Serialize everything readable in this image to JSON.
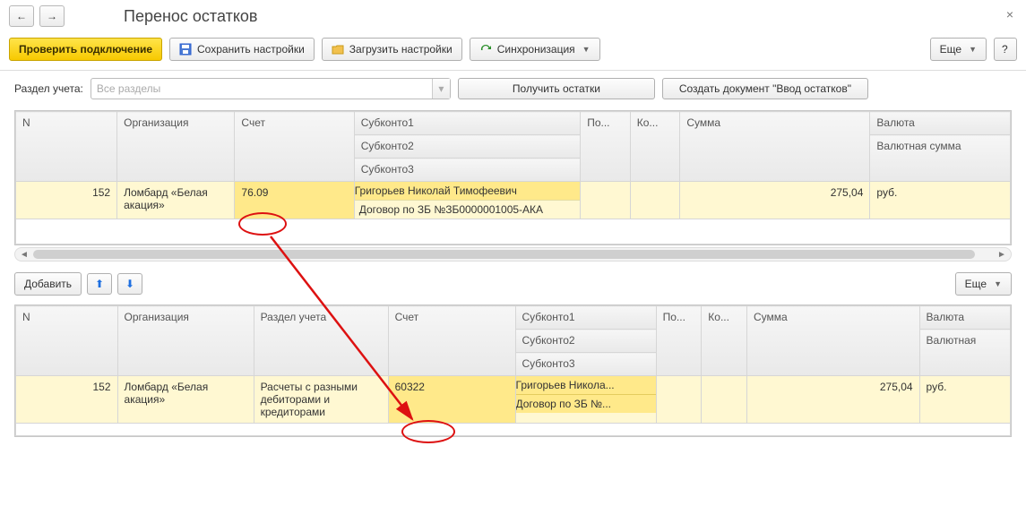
{
  "header": {
    "title": "Перенос остатков"
  },
  "nav": {
    "back_label": "←",
    "fwd_label": "→"
  },
  "toolbar": {
    "check_conn": "Проверить подключение",
    "save_settings": "Сохранить настройки",
    "load_settings": "Загрузить настройки",
    "sync": "Синхронизация",
    "more": "Еще",
    "help": "?"
  },
  "filter": {
    "label": "Раздел учета:",
    "placeholder": "Все разделы",
    "get_balances": "Получить остатки",
    "create_doc": "Создать документ \"Ввод остатков\""
  },
  "table1": {
    "cols": {
      "n": "N",
      "org": "Организация",
      "acct": "Счет",
      "sub1": "Субконто1",
      "sub2": "Субконто2",
      "sub3": "Субконто3",
      "po": "По...",
      "ko": "Ко...",
      "sum": "Сумма",
      "cur": "Валюта",
      "cur_sum": "Валютная сумма"
    },
    "row": {
      "n": "152",
      "org": "Ломбард «Белая акация»",
      "acct": "76.09",
      "sub1": "Григорьев Николай Тимофеевич",
      "sub2": "Договор по ЗБ №ЗБ0000001005-АКА",
      "sum": "275,04",
      "cur": "руб."
    }
  },
  "mid_toolbar": {
    "add": "Добавить",
    "more": "Еще"
  },
  "table2": {
    "cols": {
      "n": "N",
      "org": "Организация",
      "section": "Раздел учета",
      "acct": "Счет",
      "sub1": "Субконто1",
      "sub2": "Субконто2",
      "sub3": "Субконто3",
      "po": "По...",
      "ko": "Ко...",
      "sum": "Сумма",
      "cur": "Валюта",
      "cur_sum": "Валютная"
    },
    "row": {
      "n": "152",
      "org": "Ломбард «Белая акация»",
      "section": "Расчеты с разными дебиторами и кредиторами",
      "acct": "60322",
      "sub1": "Григорьев Никола...",
      "sub2": "Договор по ЗБ №...",
      "sum": "275,04",
      "cur": "руб."
    }
  }
}
